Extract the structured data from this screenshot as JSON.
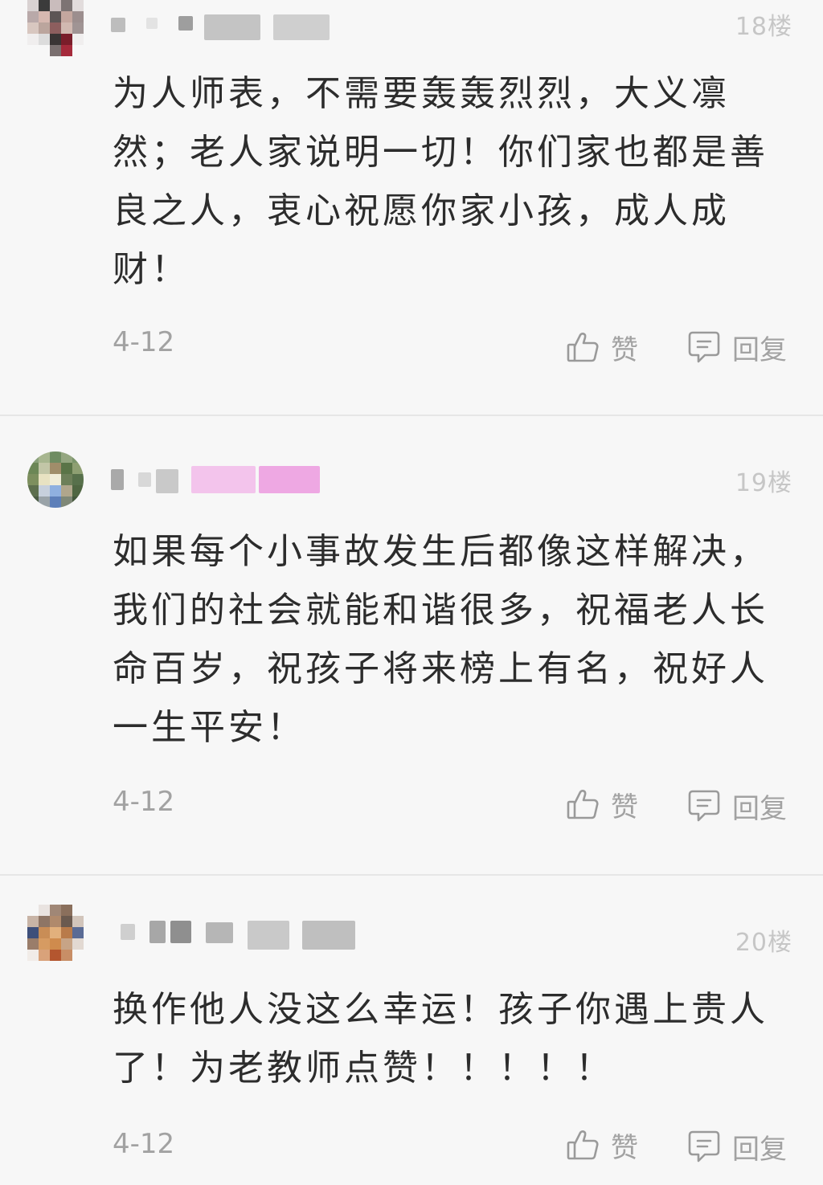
{
  "comments": [
    {
      "floor": "18楼",
      "text": "为人师表，不需要轰轰烈烈，大义凛然；老人家说明一切！你们家也都是善良之人，衷心祝愿你家小孩，成人成财！",
      "date": "4-12",
      "like_label": "赞",
      "reply_label": "回复"
    },
    {
      "floor": "19楼",
      "text": "如果每个小事故发生后都像这样解决，我们的社会就能和谐很多，祝福老人长命百岁，祝孩子将来榜上有名，祝好人一生平安！",
      "date": "4-12",
      "like_label": "赞",
      "reply_label": "回复"
    },
    {
      "floor": "20楼",
      "text": "换作他人没这么幸运！孩子你遇上贵人了！为老教师点赞！！！！！",
      "date": "4-12",
      "like_label": "赞",
      "reply_label": "回复"
    }
  ],
  "icons": {
    "like": "thumbs-up-icon",
    "reply": "speech-bubble-icon"
  },
  "colors": {
    "background": "#f7f7f7",
    "text": "#2c2c2c",
    "meta": "#a2a2a2",
    "floor": "#c6c6c6",
    "divider": "#e6e6e6"
  }
}
